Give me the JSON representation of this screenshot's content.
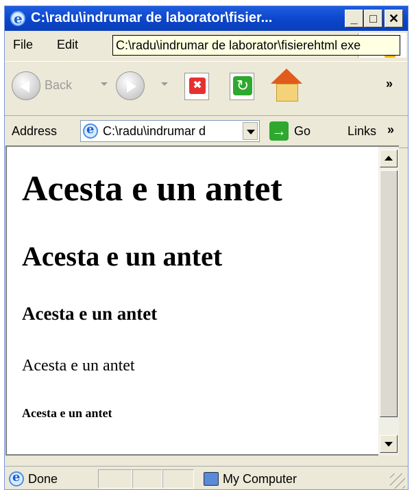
{
  "window": {
    "title": "C:\\radu\\indrumar de laborator\\fisier..."
  },
  "titlebar": {
    "minimize": "_",
    "maximize": "□",
    "close": "✕"
  },
  "menubar": {
    "items": [
      "File",
      "Edit"
    ]
  },
  "tooltip": {
    "text": "C:\\radu\\indrumar de laborator\\fisierehtml exe"
  },
  "toolbar": {
    "back_label": "Back",
    "more": "»"
  },
  "address": {
    "label": "Address",
    "value": "C:\\radu\\indrumar d",
    "go_label": "Go",
    "links_label": "Links",
    "more": "»"
  },
  "content": {
    "h1": "Acesta e un antet",
    "h2": "Acesta e un antet",
    "h3": "Acesta e un antet",
    "h4": "Acesta e un antet",
    "h5": "Acesta e un antet"
  },
  "status": {
    "text": "Done",
    "zone": "My Computer"
  }
}
